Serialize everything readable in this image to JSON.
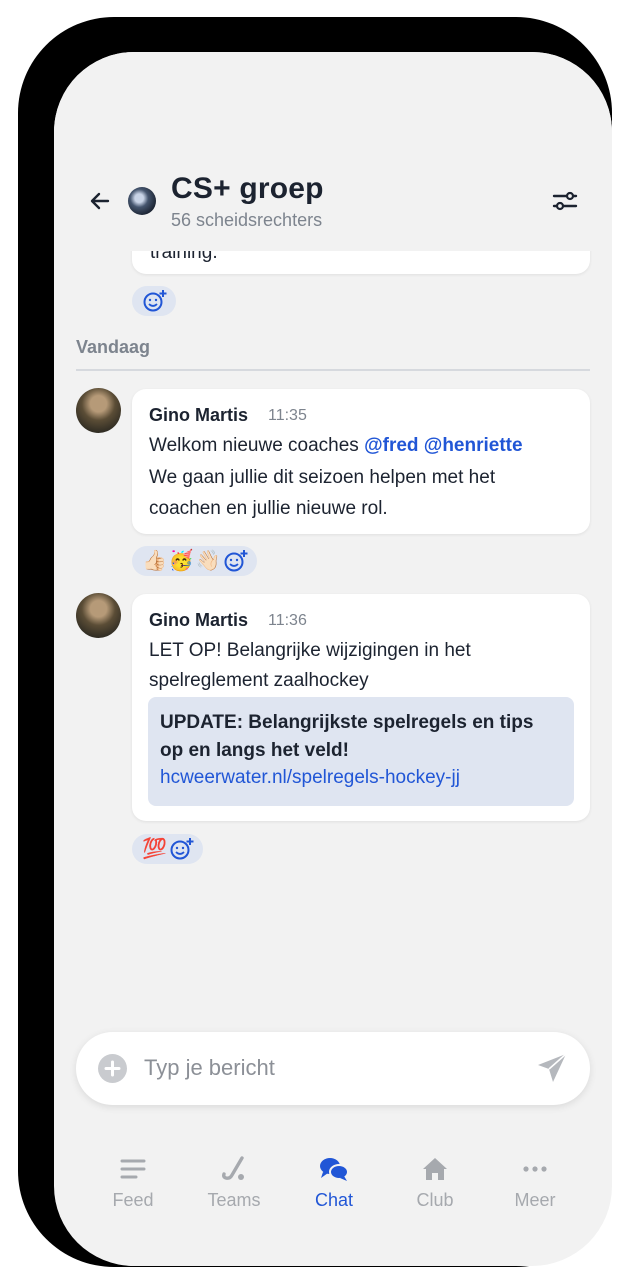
{
  "header": {
    "title": "CS+ groep",
    "subtitle": "56 scheidsrechters"
  },
  "previous_message_fragment": "training.",
  "date_divider": "Vandaag",
  "messages": [
    {
      "author": "Gino Martis",
      "time": "11:35",
      "line1_text": "Welkom nieuwe coaches ",
      "mentions": [
        "@fred",
        "@henriette"
      ],
      "line2": "We gaan jullie dit seizoen helpen met het",
      "line3": "coachen en jullie nieuwe rol.",
      "reactions": [
        "👍🏻",
        "🥳",
        "👋🏻"
      ]
    },
    {
      "author": "Gino Martis",
      "time": "11:36",
      "line1": "LET OP! Belangrijke wijzigingen in het",
      "line2": "spelreglement zaalhockey",
      "link_preview": {
        "title": "UPDATE: Belangrijkste spelregels en tips op en langs het veld!",
        "url": "hcweerwater.nl/spelregels-hockey-jj"
      },
      "reactions": [
        "💯"
      ]
    }
  ],
  "composer": {
    "placeholder": "Typ je bericht"
  },
  "tabs": [
    {
      "label": "Feed",
      "icon": "feed-icon"
    },
    {
      "label": "Teams",
      "icon": "hockey-stick-icon"
    },
    {
      "label": "Chat",
      "icon": "chat-bubbles-icon",
      "active": true
    },
    {
      "label": "Club",
      "icon": "home-icon"
    },
    {
      "label": "Meer",
      "icon": "more-dots-icon"
    }
  ],
  "colors": {
    "accent": "#2156d6",
    "background": "#f2f2f2",
    "reaction_bg": "#dfe5f1",
    "muted": "#7d848e"
  }
}
